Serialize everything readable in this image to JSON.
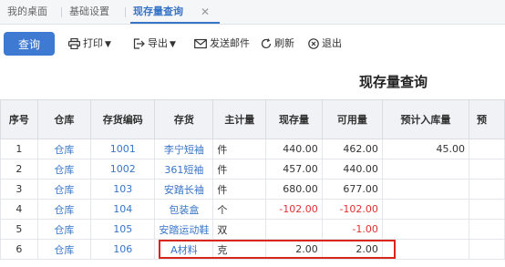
{
  "tabs": {
    "home": "我的桌面",
    "basic": "基础设置",
    "active": "现存量查询",
    "close": "✕"
  },
  "toolbar": {
    "query": "查询",
    "print": "打印",
    "export": "导出",
    "send_mail": "发送邮件",
    "refresh": "刷新",
    "exit": "退出"
  },
  "page_title": "现存量查询",
  "table": {
    "headers": [
      "序号",
      "仓库",
      "存货编码",
      "存货",
      "主计量",
      "现存量",
      "可用量",
      "预计入库量",
      "预"
    ],
    "rows": [
      {
        "no": "1",
        "warehouse": "仓库",
        "code": "1001",
        "item": "李宁短袖",
        "unit": "件",
        "stock": "440.00",
        "available": "462.00",
        "incoming": "45.00",
        "extra": ""
      },
      {
        "no": "2",
        "warehouse": "仓库",
        "code": "1002",
        "item": "361短袖",
        "unit": "件",
        "stock": "457.00",
        "available": "440.00",
        "incoming": "",
        "extra": ""
      },
      {
        "no": "3",
        "warehouse": "仓库",
        "code": "103",
        "item": "安踏长袖",
        "unit": "件",
        "stock": "680.00",
        "available": "677.00",
        "incoming": "",
        "extra": ""
      },
      {
        "no": "4",
        "warehouse": "仓库",
        "code": "104",
        "item": "包装盒",
        "unit": "个",
        "stock": "-102.00",
        "available": "-102.00",
        "incoming": "",
        "extra": ""
      },
      {
        "no": "5",
        "warehouse": "仓库",
        "code": "105",
        "item": "安踏运动鞋",
        "unit": "双",
        "stock": "",
        "available": "-1.00",
        "incoming": "",
        "extra": ""
      },
      {
        "no": "6",
        "warehouse": "仓库",
        "code": "106",
        "item": "A材料",
        "unit": "克",
        "stock": "2.00",
        "available": "2.00",
        "incoming": "",
        "extra": ""
      }
    ]
  },
  "colors": {
    "accent": "#3875c6",
    "button": "#3e7ad2",
    "negative": "#e23030",
    "highlight": "#d9251c"
  }
}
